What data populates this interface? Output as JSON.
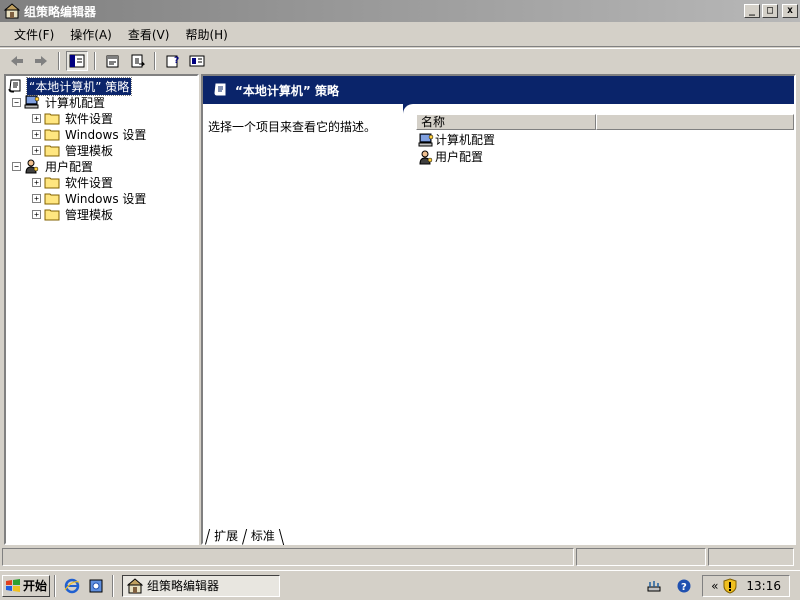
{
  "window": {
    "title": "组策略编辑器"
  },
  "menu": [
    "文件(F)",
    "操作(A)",
    "查看(V)",
    "帮助(H)"
  ],
  "tree": {
    "root": "“本地计算机” 策略",
    "computer_config": "计算机配置",
    "user_config": "用户配置",
    "children": [
      "软件设置",
      "Windows 设置",
      "管理模板"
    ],
    "expand_plus": "+",
    "collapse_minus": "−"
  },
  "right_pane": {
    "header": "“本地计算机” 策略",
    "description": "选择一个项目来查看它的描述。",
    "column_name": "名称",
    "items": [
      "计算机配置",
      "用户配置"
    ]
  },
  "tabs": [
    "扩展",
    "标准"
  ],
  "taskbar": {
    "start_label": "开始",
    "task_title": "组策略编辑器",
    "tray_chevron": "«",
    "clock": "13:16"
  },
  "colors": {
    "accent": "#0A246A",
    "face": "#D4D0C8"
  }
}
